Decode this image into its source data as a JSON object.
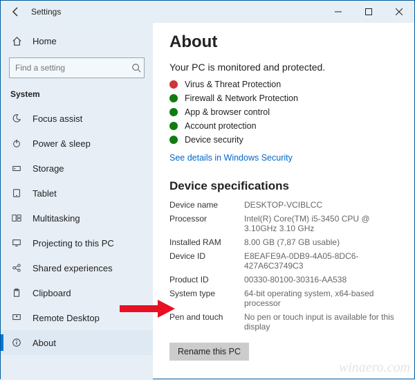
{
  "titlebar": {
    "title": "Settings"
  },
  "sidebar": {
    "home": "Home",
    "search_placeholder": "Find a setting",
    "group": "System",
    "items": [
      {
        "label": "Focus assist"
      },
      {
        "label": "Power & sleep"
      },
      {
        "label": "Storage"
      },
      {
        "label": "Tablet"
      },
      {
        "label": "Multitasking"
      },
      {
        "label": "Projecting to this PC"
      },
      {
        "label": "Shared experiences"
      },
      {
        "label": "Clipboard"
      },
      {
        "label": "Remote Desktop"
      },
      {
        "label": "About"
      }
    ]
  },
  "main": {
    "title": "About",
    "subtitle": "Your PC is monitored and protected.",
    "status": [
      {
        "label": "Virus & Threat Protection",
        "color": "#d13438"
      },
      {
        "label": "Firewall & Network Protection",
        "color": "#107c10"
      },
      {
        "label": "App & browser control",
        "color": "#107c10"
      },
      {
        "label": "Account protection",
        "color": "#107c10"
      },
      {
        "label": "Device security",
        "color": "#107c10"
      }
    ],
    "link": "See details in Windows Security",
    "spec_title": "Device specifications",
    "specs": [
      {
        "k": "Device name",
        "v": "DESKTOP-VCIBLCC"
      },
      {
        "k": "Processor",
        "v": "Intel(R) Core(TM) i5-3450 CPU @ 3.10GHz   3.10 GHz"
      },
      {
        "k": "Installed RAM",
        "v": "8.00 GB (7,87 GB usable)"
      },
      {
        "k": "Device ID",
        "v": "E8EAFE9A-0DB9-4A05-8DC6-427A6C3749C3"
      },
      {
        "k": "Product ID",
        "v": "00330-80100-30316-AA538"
      },
      {
        "k": "System type",
        "v": "64-bit operating system, x64-based processor"
      },
      {
        "k": "Pen and touch",
        "v": "No pen or touch input is available for this display"
      }
    ],
    "rename": "Rename this PC"
  },
  "watermark": "winaero.com"
}
